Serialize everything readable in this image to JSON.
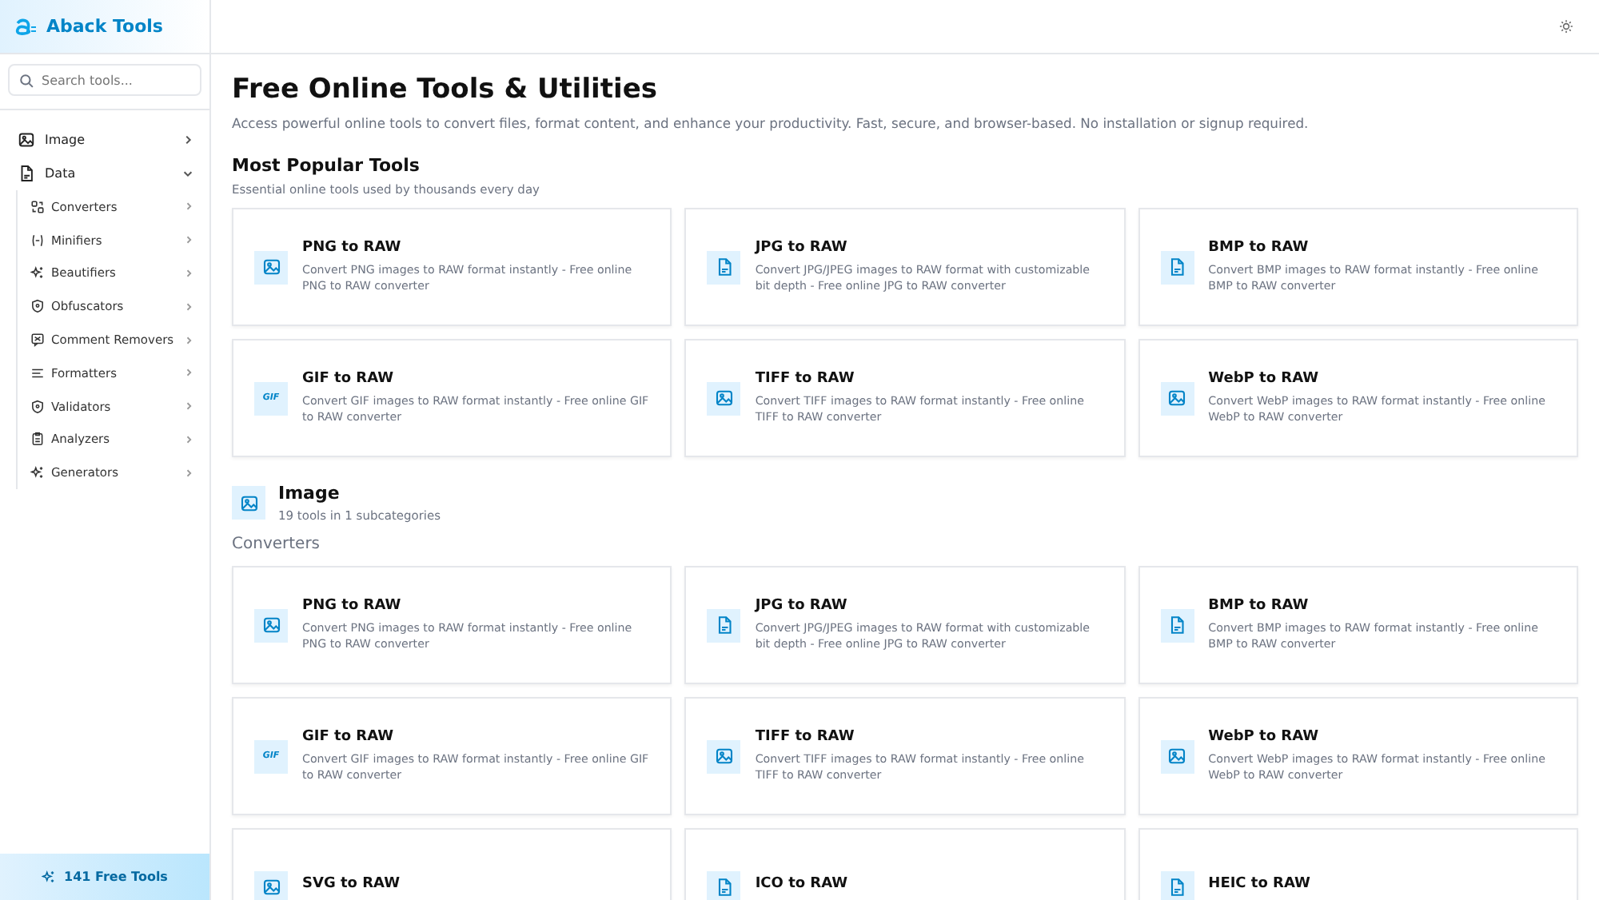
{
  "brand": {
    "name": "Aback Tools"
  },
  "search": {
    "placeholder": "Search tools..."
  },
  "sidebar": {
    "items": [
      {
        "label": "Image",
        "kind": "image",
        "expanded": false
      },
      {
        "label": "Data",
        "kind": "file",
        "expanded": true,
        "children": [
          {
            "label": "Converters",
            "kind": "convert"
          },
          {
            "label": "Minifiers",
            "kind": "minify"
          },
          {
            "label": "Beautifiers",
            "kind": "sparkle"
          },
          {
            "label": "Obfuscators",
            "kind": "shield"
          },
          {
            "label": "Comment Removers",
            "kind": "comment"
          },
          {
            "label": "Formatters",
            "kind": "lines"
          },
          {
            "label": "Validators",
            "kind": "shield"
          },
          {
            "label": "Analyzers",
            "kind": "clipboard"
          },
          {
            "label": "Generators",
            "kind": "sparkle"
          }
        ]
      }
    ]
  },
  "footer": {
    "label": "141 Free Tools"
  },
  "page": {
    "title": "Free Online Tools & Utilities",
    "subtitle": "Access powerful online tools to convert files, format content, and enhance your productivity. Fast, secure, and browser-based. No installation or signup required."
  },
  "popular": {
    "title": "Most Popular Tools",
    "subtitle": "Essential online tools used by thousands every day",
    "tools": [
      {
        "name": "PNG to RAW",
        "kind": "image",
        "description": "Convert PNG images to RAW format instantly - Free online PNG to RAW converter"
      },
      {
        "name": "JPG to RAW",
        "kind": "file",
        "description": "Convert JPG/JPEG images to RAW format with customizable bit depth - Free online JPG to RAW converter"
      },
      {
        "name": "BMP to RAW",
        "kind": "file",
        "description": "Convert BMP images to RAW format instantly - Free online BMP to RAW converter"
      },
      {
        "name": "GIF to RAW",
        "kind": "gif",
        "icon_text": "GIF",
        "description": "Convert GIF images to RAW format instantly - Free online GIF to RAW converter"
      },
      {
        "name": "TIFF to RAW",
        "kind": "image",
        "description": "Convert TIFF images to RAW format instantly - Free online TIFF to RAW converter"
      },
      {
        "name": "WebP to RAW",
        "kind": "image",
        "description": "Convert WebP images to RAW format instantly - Free online WebP to RAW converter"
      }
    ]
  },
  "category": {
    "title": "Image",
    "subtitle": "19 tools in 1 subcategories",
    "subcategory": "Converters",
    "tools": [
      {
        "name": "PNG to RAW",
        "kind": "image",
        "description": "Convert PNG images to RAW format instantly - Free online PNG to RAW converter"
      },
      {
        "name": "JPG to RAW",
        "kind": "file",
        "description": "Convert JPG/JPEG images to RAW format with customizable bit depth - Free online JPG to RAW converter"
      },
      {
        "name": "BMP to RAW",
        "kind": "file",
        "description": "Convert BMP images to RAW format instantly - Free online BMP to RAW converter"
      },
      {
        "name": "GIF to RAW",
        "kind": "gif",
        "icon_text": "GIF",
        "description": "Convert GIF images to RAW format instantly - Free online GIF to RAW converter"
      },
      {
        "name": "TIFF to RAW",
        "kind": "image",
        "description": "Convert TIFF images to RAW format instantly - Free online TIFF to RAW converter"
      },
      {
        "name": "WebP to RAW",
        "kind": "image",
        "description": "Convert WebP images to RAW format instantly - Free online WebP to RAW converter"
      },
      {
        "name": "SVG to RAW",
        "kind": "image"
      },
      {
        "name": "ICO to RAW",
        "kind": "file"
      },
      {
        "name": "HEIC to RAW",
        "kind": "file"
      }
    ]
  }
}
